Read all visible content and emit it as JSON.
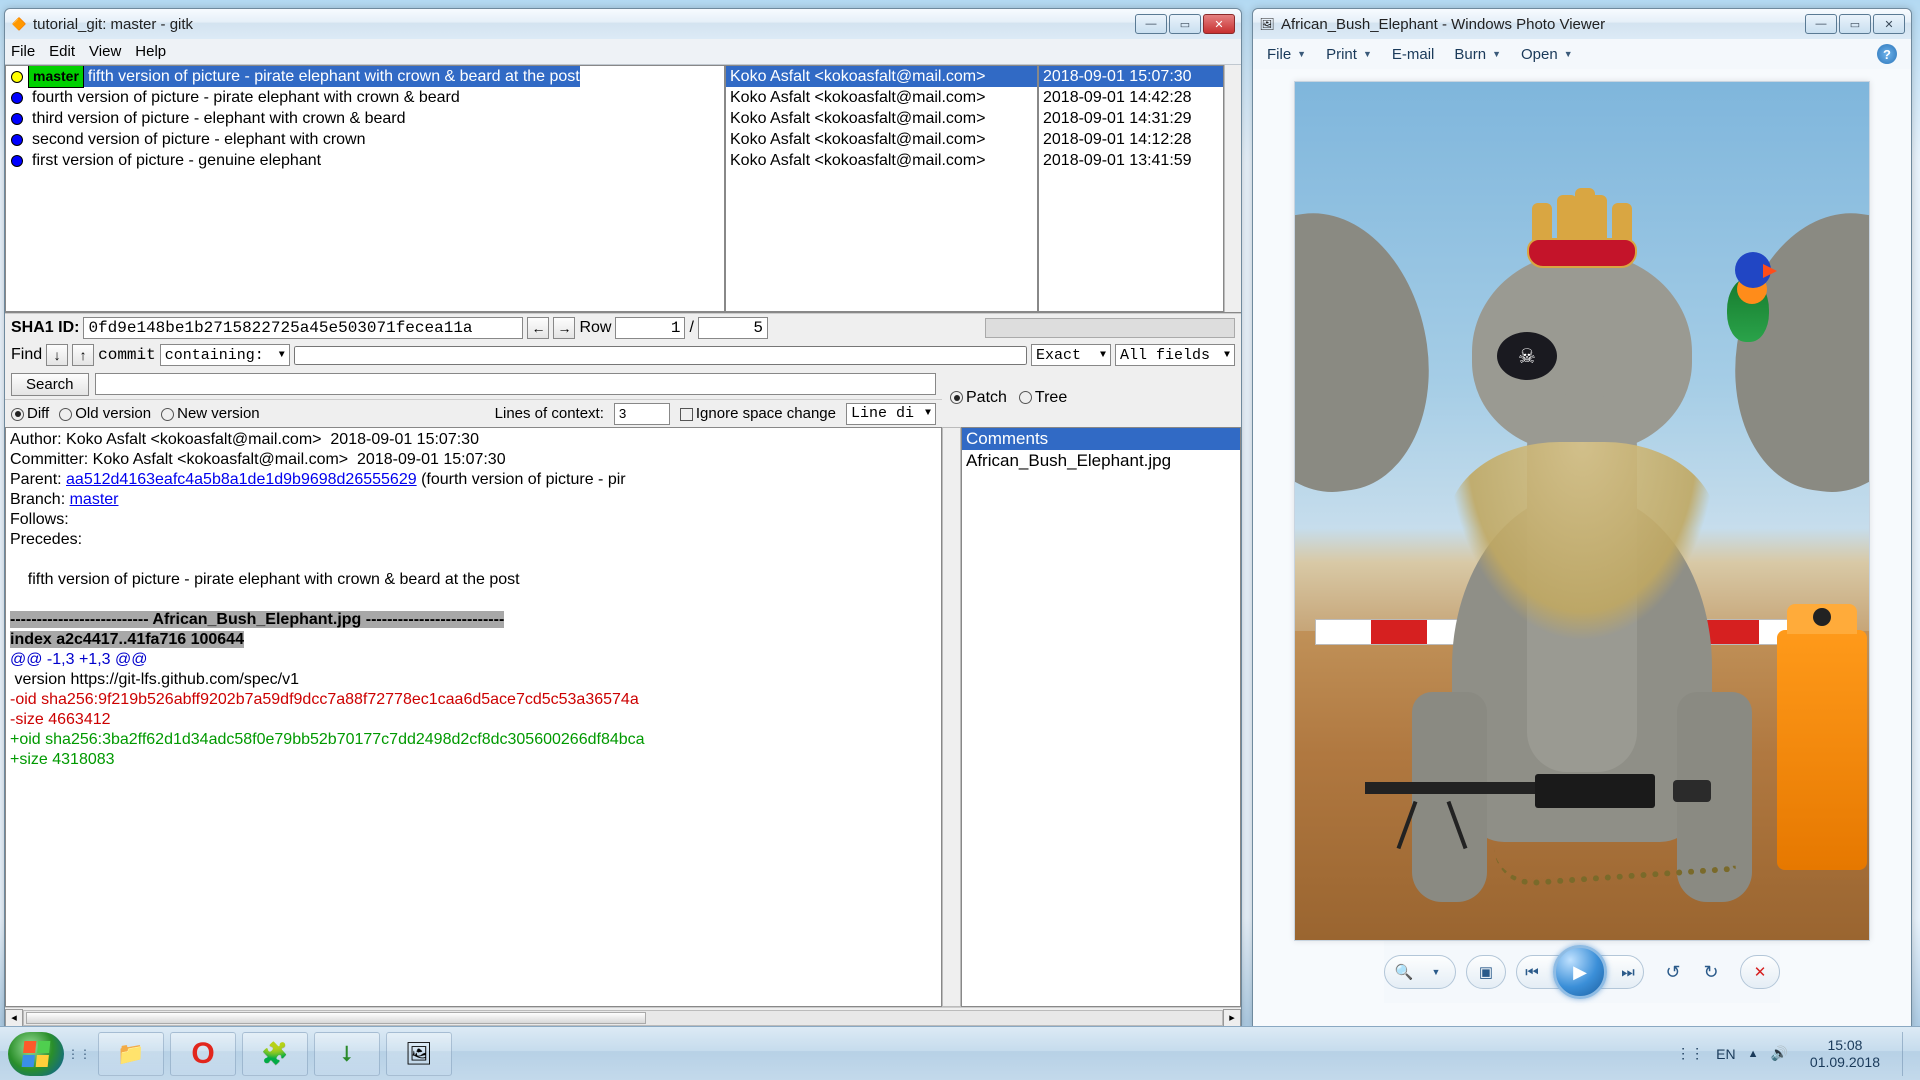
{
  "gitk": {
    "title": "tutorial_git: master - gitk",
    "menu": {
      "file": "File",
      "edit": "Edit",
      "view": "View",
      "help": "Help"
    },
    "branch_label": "master",
    "commits": [
      {
        "msg": "fifth version of picture - pirate elephant with crown & beard at the post",
        "author": "Koko Asfalt <kokoasfalt@mail.com>",
        "date": "2018-09-01 15:07:30",
        "head": true,
        "selected": true
      },
      {
        "msg": "fourth version of picture - pirate elephant with crown & beard",
        "author": "Koko Asfalt <kokoasfalt@mail.com>",
        "date": "2018-09-01 14:42:28"
      },
      {
        "msg": "third version of picture - elephant with crown & beard",
        "author": "Koko Asfalt <kokoasfalt@mail.com>",
        "date": "2018-09-01 14:31:29"
      },
      {
        "msg": "second version of picture - elephant with crown",
        "author": "Koko Asfalt <kokoasfalt@mail.com>",
        "date": "2018-09-01 14:12:28"
      },
      {
        "msg": "first version of picture - genuine elephant",
        "author": "Koko Asfalt <kokoasfalt@mail.com>",
        "date": "2018-09-01 13:41:59"
      }
    ],
    "sha_label": "SHA1 ID:",
    "sha_value": "0fd9e148be1b2715822725a45e503071fecea11a",
    "row_label": "Row",
    "row_cur": "1",
    "row_sep": "/",
    "row_total": "5",
    "find_label": "Find",
    "find_mode": "commit",
    "find_method": "containing:",
    "find_exact": "Exact",
    "find_fields": "All fields",
    "search_btn": "Search",
    "diff_radio": "Diff",
    "old_radio": "Old version",
    "new_radio": "New version",
    "lines_ctx_label": "Lines of context:",
    "lines_ctx_val": "3",
    "ignore_ws": "Ignore space change",
    "linediff": "Line di",
    "patch_radio": "Patch",
    "tree_radio": "Tree",
    "files": {
      "comments": "Comments",
      "file1": "African_Bush_Elephant.jpg"
    },
    "diff": {
      "author_line": "Author: Koko Asfalt <kokoasfalt@mail.com>  2018-09-01 15:07:30",
      "committer_line": "Committer: Koko Asfalt <kokoasfalt@mail.com>  2018-09-01 15:07:30",
      "parent_label": "Parent: ",
      "parent_sha": "aa512d4163eafc4a5b8a1de1d9b9698d26555629",
      "parent_msg": " (fourth version of picture - pir",
      "branch_label": "Branch: ",
      "branch_link": "master",
      "follows": "Follows:",
      "precedes": "Precedes:",
      "subject": "    fifth version of picture - pirate elephant with crown & beard at the post",
      "sep": "-------------------------- African_Bush_Elephant.jpg --------------------------",
      "index": "index a2c4417..41fa716 100644",
      "hunk": "@@ -1,3 +1,3 @@",
      "ctx": " version https://git-lfs.github.com/spec/v1",
      "del1": "-oid sha256:9f219b526abff9202b7a59df9dcc7a88f72778ec1caa6d5ace7cd5c53a36574a",
      "del2": "-size 4663412",
      "add1": "+oid sha256:3ba2ff62d1d34adc58f0e79bb52b70177c7dd2498d2cf8dc305600266df84bca",
      "add2": "+size 4318083"
    }
  },
  "photo": {
    "title": "African_Bush_Elephant - Windows Photo Viewer",
    "menu": {
      "file": "File",
      "print": "Print",
      "email": "E-mail",
      "burn": "Burn",
      "open": "Open"
    }
  },
  "taskbar": {
    "lang": "EN",
    "time": "15:08",
    "date": "01.09.2018"
  }
}
